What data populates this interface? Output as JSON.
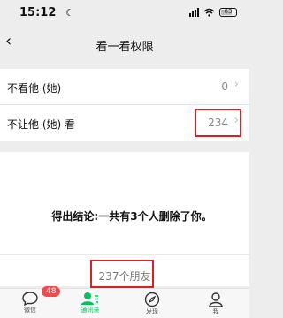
{
  "status": {
    "time": "15:12",
    "moon_icon": "☾",
    "battery": "63"
  },
  "nav": {
    "back_glyph": "‹",
    "title": "看一看权限"
  },
  "settings": [
    {
      "label": "不看他 (她)",
      "value": "0"
    },
    {
      "label": "不让他 (她) 看",
      "value": "234"
    }
  ],
  "conclusion": "得出结论:一共有3个人删除了你。",
  "friends_count": "237个朋友",
  "tabs": [
    {
      "icon": "chat-icon",
      "label": "微信",
      "badge": "48"
    },
    {
      "icon": "contacts-icon",
      "label": "通讯录",
      "badge": ""
    },
    {
      "icon": "compass-icon",
      "label": "发现",
      "badge": ""
    },
    {
      "icon": "person-icon",
      "label": "我",
      "badge": ""
    }
  ],
  "colors": {
    "accent_green": "#07c160",
    "highlight_red": "#d62222",
    "badge_red": "#f04b4b"
  }
}
